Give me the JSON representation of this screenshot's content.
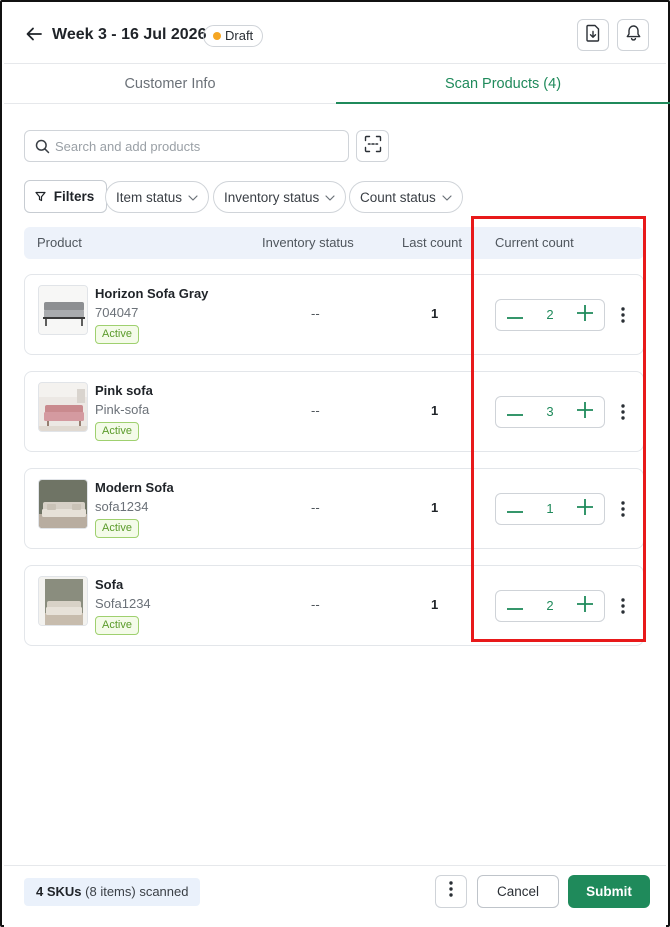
{
  "header": {
    "title": "Week 3 - 16 Jul 2026",
    "status_badge": "Draft",
    "status_color": "#f5a623"
  },
  "tabs": [
    {
      "label": "Customer Info",
      "active": false
    },
    {
      "label": "Scan Products (4)",
      "active": true
    }
  ],
  "search": {
    "placeholder": "Search and add products",
    "value": ""
  },
  "filters": {
    "filters_label": "Filters",
    "item_status": "Item status",
    "inventory_status": "Inventory status",
    "count_status": "Count status"
  },
  "table": {
    "columns": {
      "product": "Product",
      "inventory_status": "Inventory status",
      "last_count": "Last count",
      "current_count": "Current count"
    },
    "rows": [
      {
        "name": "Horizon Sofa Gray",
        "sku": "704047",
        "status": "Active",
        "inventory": "--",
        "last_count": "1",
        "current_count": "2"
      },
      {
        "name": "Pink sofa",
        "sku": "Pink-sofa",
        "status": "Active",
        "inventory": "--",
        "last_count": "1",
        "current_count": "3"
      },
      {
        "name": "Modern Sofa",
        "sku": "sofa1234",
        "status": "Active",
        "inventory": "--",
        "last_count": "1",
        "current_count": "1"
      },
      {
        "name": "Sofa",
        "sku": "Sofa1234",
        "status": "Active",
        "inventory": "--",
        "last_count": "1",
        "current_count": "2"
      }
    ]
  },
  "footer": {
    "skus": "4 SKUs",
    "items": "(8 items) scanned",
    "cancel_label": "Cancel",
    "submit_label": "Submit"
  },
  "colors": {
    "accent": "#1f8a5b",
    "highlight": "#e8191a",
    "active_badge": "#5a9b2a"
  }
}
